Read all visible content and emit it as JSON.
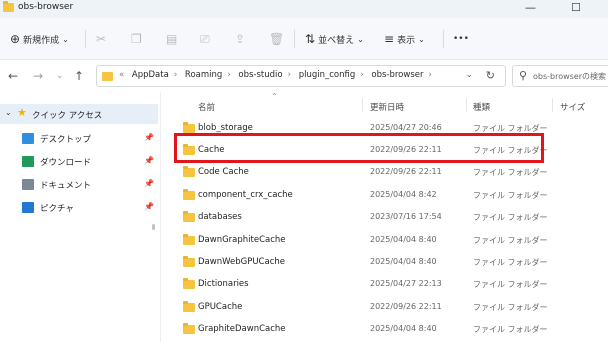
{
  "window": {
    "title": "obs-browser",
    "controls": {
      "minimize": "—",
      "maximize": "☐",
      "close": "✕"
    }
  },
  "toolbar": {
    "new_label": "新規作成",
    "sort_label": "並べ替え",
    "view_label": "表示",
    "more_label": "•••"
  },
  "address": {
    "overflow": "«",
    "crumbs": [
      "AppData",
      "Roaming",
      "obs-studio",
      "plugin_config",
      "obs-browser"
    ],
    "search_placeholder": "obs-browserの検索"
  },
  "nav_pane": {
    "quick_access": "クイック アクセス",
    "items": [
      {
        "label": "デスクトップ",
        "icon": "desktop-icon",
        "color": "#2f8ee0"
      },
      {
        "label": "ダウンロード",
        "icon": "download-icon",
        "color": "#1f9a5a"
      },
      {
        "label": "ドキュメント",
        "icon": "document-icon",
        "color": "#7b8794"
      },
      {
        "label": "ピクチャ",
        "icon": "picture-icon",
        "color": "#1f7ad1"
      }
    ]
  },
  "file_list": {
    "columns": {
      "name": "名前",
      "date": "更新日時",
      "type": "種類",
      "size": "サイズ"
    },
    "rows": [
      {
        "name": "blob_storage",
        "date": "2025/04/27 20:46",
        "type": "ファイル フォルダー"
      },
      {
        "name": "Cache",
        "date": "2022/09/26 22:11",
        "type": "ファイル フォルダー"
      },
      {
        "name": "Code Cache",
        "date": "2022/09/26 22:11",
        "type": "ファイル フォルダー"
      },
      {
        "name": "component_crx_cache",
        "date": "2025/04/04 8:42",
        "type": "ファイル フォルダー"
      },
      {
        "name": "databases",
        "date": "2023/07/16 17:54",
        "type": "ファイル フォルダー"
      },
      {
        "name": "DawnGraphiteCache",
        "date": "2025/04/04 8:40",
        "type": "ファイル フォルダー"
      },
      {
        "name": "DawnWebGPUCache",
        "date": "2025/04/04 8:40",
        "type": "ファイル フォルダー"
      },
      {
        "name": "Dictionaries",
        "date": "2025/04/27 22:13",
        "type": "ファイル フォルダー"
      },
      {
        "name": "GPUCache",
        "date": "2022/09/26 22:11",
        "type": "ファイル フォルダー"
      },
      {
        "name": "GraphiteDawnCache",
        "date": "2025/04/04 8:40",
        "type": "ファイル フォルダー"
      }
    ]
  },
  "colors": {
    "highlight": "#e0161b",
    "folder": "#f5c542",
    "selected_bg": "#e6eef8"
  }
}
